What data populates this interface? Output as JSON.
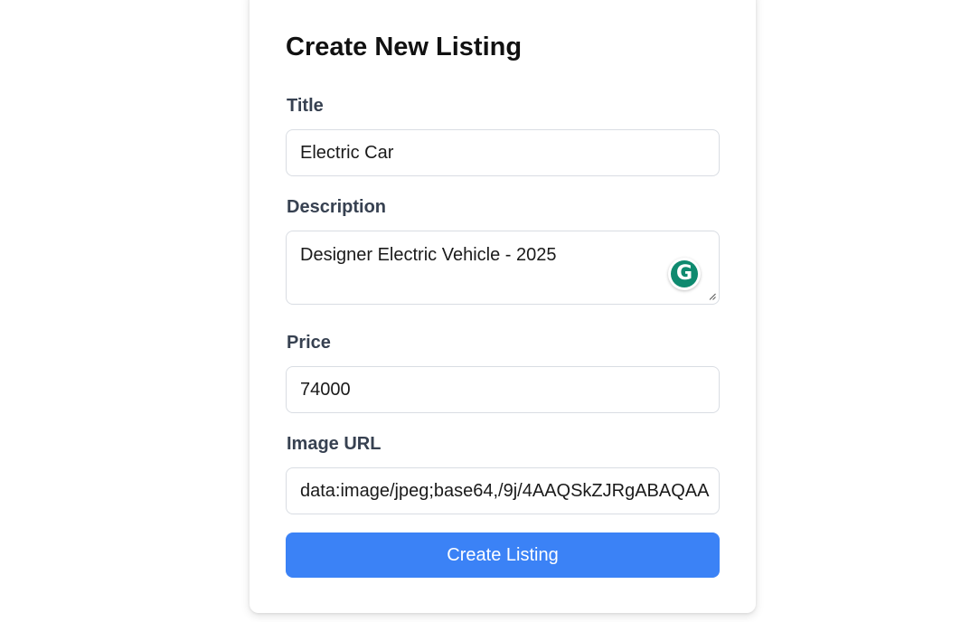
{
  "form": {
    "title": "Create New Listing",
    "fields": {
      "title": {
        "label": "Title",
        "value": "Electric Car"
      },
      "description": {
        "label": "Description",
        "value": "Designer Electric Vehicle - 2025"
      },
      "price": {
        "label": "Price",
        "value": "74000"
      },
      "image_url": {
        "label": "Image URL",
        "value": "data:image/jpeg;base64,/9j/4AAQSkZJRgABAQAA"
      }
    },
    "submit_label": "Create Listing"
  },
  "extension": {
    "grammarly_icon_letter": "G",
    "icon_name": "grammarly-icon"
  },
  "colors": {
    "accent": "#3b82f6",
    "grammarly": "#0e8a6f",
    "label": "#374151",
    "heading": "#111111"
  }
}
